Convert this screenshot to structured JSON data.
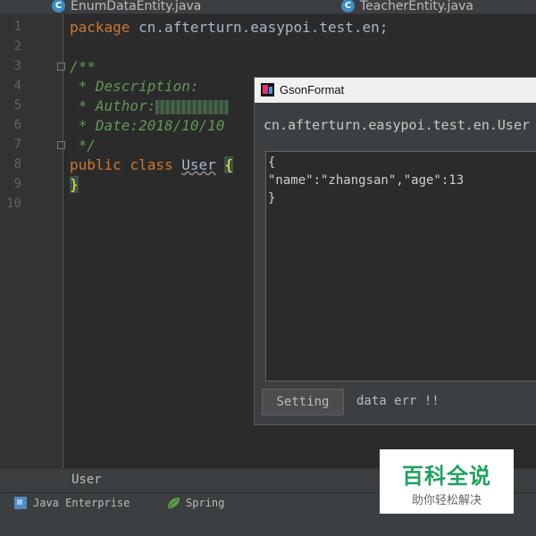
{
  "tabs": [
    {
      "label": "EnumDataEntity.java",
      "icon": "class-icon",
      "letter": "C"
    },
    {
      "label": "TeacherEntity.java",
      "icon": "class-icon",
      "letter": "C"
    }
  ],
  "line_numbers": [
    "1",
    "2",
    "3",
    "4",
    "5",
    "6",
    "7",
    "8",
    "9",
    "10"
  ],
  "code": {
    "package_kw": "package",
    "package_name": " cn.afterturn.easypoi.test.en;",
    "doc_open": "/**",
    "doc_desc": " * Description:",
    "doc_author": " * Author:",
    "doc_date": " * Date:2018/10/10",
    "doc_close": " */",
    "public_kw": "public",
    "class_kw": "class",
    "class_name": "User",
    "open_brace": "{",
    "close_brace": "}"
  },
  "dialog": {
    "title": "GsonFormat",
    "class_path": "cn.afterturn.easypoi.test.en.User",
    "json_text": "{\n\"name\":\"zhangsan\",\"age\":13\n}",
    "setting_label": "Setting",
    "status_text": "data err !!"
  },
  "breadcrumb": "User",
  "statusbar": {
    "java_enterprise": "Java Enterprise",
    "spring": "Spring"
  },
  "watermark": {
    "title": "百科全说",
    "subtitle": "助你轻松解决"
  },
  "colors": {
    "editor_bg": "#2b2b2b",
    "keyword": "#cc7832",
    "comment": "#629755",
    "brace": "#ffef28",
    "watermark_green": "#1fa15f"
  }
}
